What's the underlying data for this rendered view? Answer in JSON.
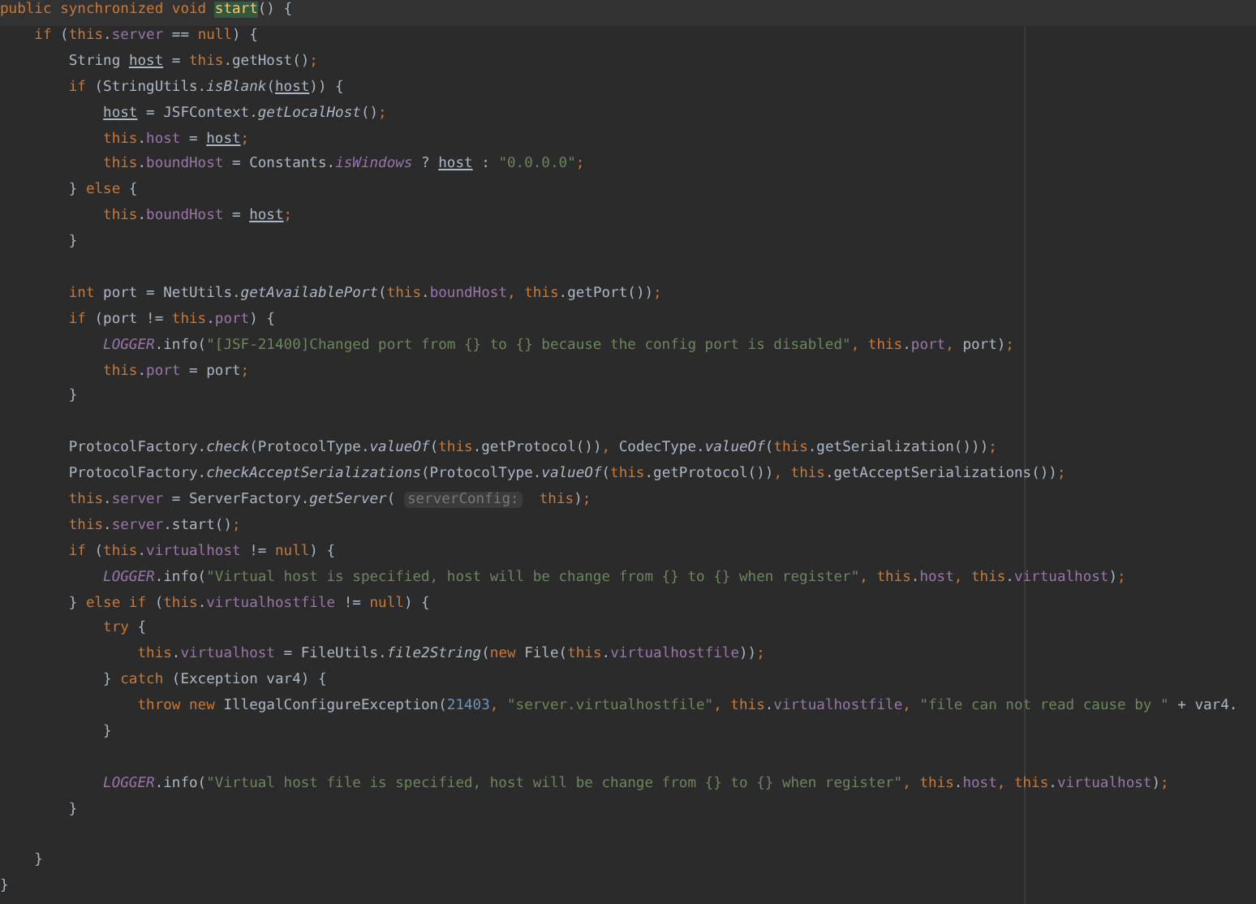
{
  "editor": {
    "lines": [
      {
        "kind": "code",
        "current": true,
        "tokens": [
          {
            "kind": "kw",
            "text": "public synchronized void "
          },
          {
            "kind": "hl",
            "text": "start"
          },
          {
            "kind": "p",
            "text": "() {"
          }
        ],
        "children": [
          {
            "kind": "code",
            "tokens": [
              {
                "kind": "kw",
                "text": "if"
              },
              {
                "kind": "p",
                "text": " ("
              },
              {
                "kind": "kw",
                "text": "this"
              },
              {
                "kind": "p",
                "text": "."
              },
              {
                "kind": "f",
                "text": "server"
              },
              {
                "kind": "p",
                "text": " == "
              },
              {
                "kind": "kw",
                "text": "null"
              },
              {
                "kind": "p",
                "text": ") {"
              }
            ],
            "children": [
              {
                "kind": "code",
                "tokens": [
                  {
                    "kind": "p",
                    "text": "String "
                  },
                  {
                    "kind": "u",
                    "text": "host"
                  },
                  {
                    "kind": "p",
                    "text": " = "
                  },
                  {
                    "kind": "kw",
                    "text": "this"
                  },
                  {
                    "kind": "p",
                    "text": ".getHost()"
                  },
                  {
                    "kind": "kw",
                    "text": ";"
                  }
                ]
              },
              {
                "kind": "code",
                "tokens": [
                  {
                    "kind": "kw",
                    "text": "if"
                  },
                  {
                    "kind": "p",
                    "text": " (StringUtils."
                  },
                  {
                    "kind": "m",
                    "text": "isBlank"
                  },
                  {
                    "kind": "p",
                    "text": "("
                  },
                  {
                    "kind": "u",
                    "text": "host"
                  },
                  {
                    "kind": "p",
                    "text": ")) {"
                  }
                ],
                "children": [
                  {
                    "kind": "code",
                    "tokens": [
                      {
                        "kind": "u",
                        "text": "host"
                      },
                      {
                        "kind": "p",
                        "text": " = JSFContext."
                      },
                      {
                        "kind": "m",
                        "text": "getLocalHost"
                      },
                      {
                        "kind": "p",
                        "text": "()"
                      },
                      {
                        "kind": "kw",
                        "text": ";"
                      }
                    ]
                  },
                  {
                    "kind": "code",
                    "tokens": [
                      {
                        "kind": "kw",
                        "text": "this"
                      },
                      {
                        "kind": "p",
                        "text": "."
                      },
                      {
                        "kind": "f",
                        "text": "host"
                      },
                      {
                        "kind": "p",
                        "text": " = "
                      },
                      {
                        "kind": "u",
                        "text": "host"
                      },
                      {
                        "kind": "kw",
                        "text": ";"
                      }
                    ]
                  },
                  {
                    "kind": "code",
                    "tokens": [
                      {
                        "kind": "kw",
                        "text": "this"
                      },
                      {
                        "kind": "p",
                        "text": "."
                      },
                      {
                        "kind": "f",
                        "text": "boundHost"
                      },
                      {
                        "kind": "p",
                        "text": " = Constants."
                      },
                      {
                        "kind": "sf",
                        "text": "isWindows"
                      },
                      {
                        "kind": "p",
                        "text": " ? "
                      },
                      {
                        "kind": "u",
                        "text": "host"
                      },
                      {
                        "kind": "p",
                        "text": " : "
                      },
                      {
                        "kind": "s",
                        "text": "\"0.0.0.0\""
                      },
                      {
                        "kind": "kw",
                        "text": ";"
                      }
                    ]
                  }
                ]
              },
              {
                "kind": "code",
                "tokens": [
                  {
                    "kind": "p",
                    "text": "} "
                  },
                  {
                    "kind": "kw",
                    "text": "else"
                  },
                  {
                    "kind": "p",
                    "text": " {"
                  }
                ],
                "children": [
                  {
                    "kind": "code",
                    "tokens": [
                      {
                        "kind": "kw",
                        "text": "this"
                      },
                      {
                        "kind": "p",
                        "text": "."
                      },
                      {
                        "kind": "f",
                        "text": "boundHost"
                      },
                      {
                        "kind": "p",
                        "text": " = "
                      },
                      {
                        "kind": "u",
                        "text": "host"
                      },
                      {
                        "kind": "kw",
                        "text": ";"
                      }
                    ]
                  }
                ]
              },
              {
                "kind": "code",
                "tokens": [
                  {
                    "kind": "p",
                    "text": "}"
                  }
                ]
              },
              {
                "kind": "blank"
              },
              {
                "kind": "code",
                "tokens": [
                  {
                    "kind": "kw",
                    "text": "int"
                  },
                  {
                    "kind": "p",
                    "text": " port = NetUtils."
                  },
                  {
                    "kind": "m",
                    "text": "getAvailablePort"
                  },
                  {
                    "kind": "p",
                    "text": "("
                  },
                  {
                    "kind": "kw",
                    "text": "this"
                  },
                  {
                    "kind": "p",
                    "text": "."
                  },
                  {
                    "kind": "f",
                    "text": "boundHost"
                  },
                  {
                    "kind": "kw",
                    "text": ", "
                  },
                  {
                    "kind": "kw",
                    "text": "this"
                  },
                  {
                    "kind": "p",
                    "text": ".getPort())"
                  },
                  {
                    "kind": "kw",
                    "text": ";"
                  }
                ]
              },
              {
                "kind": "code",
                "tokens": [
                  {
                    "kind": "kw",
                    "text": "if"
                  },
                  {
                    "kind": "p",
                    "text": " (port != "
                  },
                  {
                    "kind": "kw",
                    "text": "this"
                  },
                  {
                    "kind": "p",
                    "text": "."
                  },
                  {
                    "kind": "f",
                    "text": "port"
                  },
                  {
                    "kind": "p",
                    "text": ") {"
                  }
                ],
                "children": [
                  {
                    "kind": "code",
                    "tokens": [
                      {
                        "kind": "sf",
                        "text": "LOGGER"
                      },
                      {
                        "kind": "p",
                        "text": ".info("
                      },
                      {
                        "kind": "s",
                        "text": "\"[JSF-21400]Changed port from {} to {} because the config port is disabled\""
                      },
                      {
                        "kind": "kw",
                        "text": ", this"
                      },
                      {
                        "kind": "p",
                        "text": "."
                      },
                      {
                        "kind": "f",
                        "text": "port"
                      },
                      {
                        "kind": "kw",
                        "text": ", "
                      },
                      {
                        "kind": "p",
                        "text": "port)"
                      },
                      {
                        "kind": "kw",
                        "text": ";"
                      }
                    ]
                  },
                  {
                    "kind": "code",
                    "tokens": [
                      {
                        "kind": "kw",
                        "text": "this"
                      },
                      {
                        "kind": "p",
                        "text": "."
                      },
                      {
                        "kind": "f",
                        "text": "port"
                      },
                      {
                        "kind": "p",
                        "text": " = port"
                      },
                      {
                        "kind": "kw",
                        "text": ";"
                      }
                    ]
                  }
                ]
              },
              {
                "kind": "code",
                "tokens": [
                  {
                    "kind": "p",
                    "text": "}"
                  }
                ]
              },
              {
                "kind": "blank"
              },
              {
                "kind": "code",
                "tokens": [
                  {
                    "kind": "p",
                    "text": "ProtocolFactory."
                  },
                  {
                    "kind": "m",
                    "text": "check"
                  },
                  {
                    "kind": "p",
                    "text": "(ProtocolType."
                  },
                  {
                    "kind": "m",
                    "text": "valueOf"
                  },
                  {
                    "kind": "p",
                    "text": "("
                  },
                  {
                    "kind": "kw",
                    "text": "this"
                  },
                  {
                    "kind": "p",
                    "text": ".getProtocol())"
                  },
                  {
                    "kind": "kw",
                    "text": ", "
                  },
                  {
                    "kind": "p",
                    "text": "CodecType."
                  },
                  {
                    "kind": "m",
                    "text": "valueOf"
                  },
                  {
                    "kind": "p",
                    "text": "("
                  },
                  {
                    "kind": "kw",
                    "text": "this"
                  },
                  {
                    "kind": "p",
                    "text": ".getSerialization()))"
                  },
                  {
                    "kind": "kw",
                    "text": ";"
                  }
                ]
              },
              {
                "kind": "code",
                "tokens": [
                  {
                    "kind": "p",
                    "text": "ProtocolFactory."
                  },
                  {
                    "kind": "m",
                    "text": "checkAcceptSerializations"
                  },
                  {
                    "kind": "p",
                    "text": "(ProtocolType."
                  },
                  {
                    "kind": "m",
                    "text": "valueOf"
                  },
                  {
                    "kind": "p",
                    "text": "("
                  },
                  {
                    "kind": "kw",
                    "text": "this"
                  },
                  {
                    "kind": "p",
                    "text": ".getProtocol())"
                  },
                  {
                    "kind": "kw",
                    "text": ", this"
                  },
                  {
                    "kind": "p",
                    "text": ".getAcceptSerializations())"
                  },
                  {
                    "kind": "kw",
                    "text": ";"
                  }
                ]
              },
              {
                "kind": "code",
                "tokens": [
                  {
                    "kind": "kw",
                    "text": "this"
                  },
                  {
                    "kind": "p",
                    "text": "."
                  },
                  {
                    "kind": "f",
                    "text": "server"
                  },
                  {
                    "kind": "p",
                    "text": " = ServerFactory."
                  },
                  {
                    "kind": "m",
                    "text": "getServer"
                  },
                  {
                    "kind": "p",
                    "text": "( "
                  },
                  {
                    "kind": "hint",
                    "text": "serverConfig:"
                  },
                  {
                    "kind": "kw",
                    "text": " this"
                  },
                  {
                    "kind": "p",
                    "text": ")"
                  },
                  {
                    "kind": "kw",
                    "text": ";"
                  }
                ]
              },
              {
                "kind": "code",
                "tokens": [
                  {
                    "kind": "kw",
                    "text": "this"
                  },
                  {
                    "kind": "p",
                    "text": "."
                  },
                  {
                    "kind": "f",
                    "text": "server"
                  },
                  {
                    "kind": "p",
                    "text": ".start()"
                  },
                  {
                    "kind": "kw",
                    "text": ";"
                  }
                ]
              },
              {
                "kind": "code",
                "tokens": [
                  {
                    "kind": "kw",
                    "text": "if"
                  },
                  {
                    "kind": "p",
                    "text": " ("
                  },
                  {
                    "kind": "kw",
                    "text": "this"
                  },
                  {
                    "kind": "p",
                    "text": "."
                  },
                  {
                    "kind": "f",
                    "text": "virtualhost"
                  },
                  {
                    "kind": "p",
                    "text": " != "
                  },
                  {
                    "kind": "kw",
                    "text": "null"
                  },
                  {
                    "kind": "p",
                    "text": ") {"
                  }
                ],
                "children": [
                  {
                    "kind": "code",
                    "tokens": [
                      {
                        "kind": "sf",
                        "text": "LOGGER"
                      },
                      {
                        "kind": "p",
                        "text": ".info("
                      },
                      {
                        "kind": "s",
                        "text": "\"Virtual host is specified, host will be change from {} to {} when register\""
                      },
                      {
                        "kind": "kw",
                        "text": ", this"
                      },
                      {
                        "kind": "p",
                        "text": "."
                      },
                      {
                        "kind": "f",
                        "text": "host"
                      },
                      {
                        "kind": "kw",
                        "text": ", this"
                      },
                      {
                        "kind": "p",
                        "text": "."
                      },
                      {
                        "kind": "f",
                        "text": "virtualhost"
                      },
                      {
                        "kind": "p",
                        "text": ")"
                      },
                      {
                        "kind": "kw",
                        "text": ";"
                      }
                    ]
                  }
                ]
              },
              {
                "kind": "code",
                "tokens": [
                  {
                    "kind": "p",
                    "text": "} "
                  },
                  {
                    "kind": "kw",
                    "text": "else if"
                  },
                  {
                    "kind": "p",
                    "text": " ("
                  },
                  {
                    "kind": "kw",
                    "text": "this"
                  },
                  {
                    "kind": "p",
                    "text": "."
                  },
                  {
                    "kind": "f",
                    "text": "virtualhostfile"
                  },
                  {
                    "kind": "p",
                    "text": " != "
                  },
                  {
                    "kind": "kw",
                    "text": "null"
                  },
                  {
                    "kind": "p",
                    "text": ") {"
                  }
                ],
                "children": [
                  {
                    "kind": "code",
                    "tokens": [
                      {
                        "kind": "kw",
                        "text": "try"
                      },
                      {
                        "kind": "p",
                        "text": " {"
                      }
                    ],
                    "children": [
                      {
                        "kind": "code",
                        "tokens": [
                          {
                            "kind": "kw",
                            "text": "this"
                          },
                          {
                            "kind": "p",
                            "text": "."
                          },
                          {
                            "kind": "f",
                            "text": "virtualhost"
                          },
                          {
                            "kind": "p",
                            "text": " = FileUtils."
                          },
                          {
                            "kind": "m",
                            "text": "file2String"
                          },
                          {
                            "kind": "p",
                            "text": "("
                          },
                          {
                            "kind": "kw",
                            "text": "new"
                          },
                          {
                            "kind": "p",
                            "text": " File("
                          },
                          {
                            "kind": "kw",
                            "text": "this"
                          },
                          {
                            "kind": "p",
                            "text": "."
                          },
                          {
                            "kind": "f",
                            "text": "virtualhostfile"
                          },
                          {
                            "kind": "p",
                            "text": "))"
                          },
                          {
                            "kind": "kw",
                            "text": ";"
                          }
                        ]
                      }
                    ]
                  },
                  {
                    "kind": "code",
                    "tokens": [
                      {
                        "kind": "p",
                        "text": "} "
                      },
                      {
                        "kind": "kw",
                        "text": "catch"
                      },
                      {
                        "kind": "p",
                        "text": " (Exception var4) {"
                      }
                    ],
                    "children": [
                      {
                        "kind": "code",
                        "tokens": [
                          {
                            "kind": "kw",
                            "text": "throw new"
                          },
                          {
                            "kind": "p",
                            "text": " IllegalConfigureException("
                          },
                          {
                            "kind": "n",
                            "text": "21403"
                          },
                          {
                            "kind": "kw",
                            "text": ", "
                          },
                          {
                            "kind": "s",
                            "text": "\"server.virtualhostfile\""
                          },
                          {
                            "kind": "kw",
                            "text": ", this"
                          },
                          {
                            "kind": "p",
                            "text": "."
                          },
                          {
                            "kind": "f",
                            "text": "virtualhostfile"
                          },
                          {
                            "kind": "kw",
                            "text": ", "
                          },
                          {
                            "kind": "s",
                            "text": "\"file can not read cause by \""
                          },
                          {
                            "kind": "p",
                            "text": " + var4."
                          }
                        ]
                      }
                    ]
                  },
                  {
                    "kind": "code",
                    "tokens": [
                      {
                        "kind": "p",
                        "text": "}"
                      }
                    ]
                  },
                  {
                    "kind": "blank"
                  },
                  {
                    "kind": "code",
                    "tokens": [
                      {
                        "kind": "sf",
                        "text": "LOGGER"
                      },
                      {
                        "kind": "p",
                        "text": ".info("
                      },
                      {
                        "kind": "s",
                        "text": "\"Virtual host file is specified, host will be change from {} to {} when register\""
                      },
                      {
                        "kind": "kw",
                        "text": ", this"
                      },
                      {
                        "kind": "p",
                        "text": "."
                      },
                      {
                        "kind": "f",
                        "text": "host"
                      },
                      {
                        "kind": "kw",
                        "text": ", this"
                      },
                      {
                        "kind": "p",
                        "text": "."
                      },
                      {
                        "kind": "f",
                        "text": "virtualhost"
                      },
                      {
                        "kind": "p",
                        "text": ")"
                      },
                      {
                        "kind": "kw",
                        "text": ";"
                      }
                    ]
                  }
                ]
              },
              {
                "kind": "code",
                "tokens": [
                  {
                    "kind": "p",
                    "text": "}"
                  }
                ]
              },
              {
                "kind": "blank"
              }
            ]
          },
          {
            "kind": "code",
            "tokens": [
              {
                "kind": "p",
                "text": "}"
              }
            ]
          }
        ]
      },
      {
        "kind": "code",
        "tokens": [
          {
            "kind": "p",
            "text": "}"
          }
        ]
      }
    ]
  }
}
